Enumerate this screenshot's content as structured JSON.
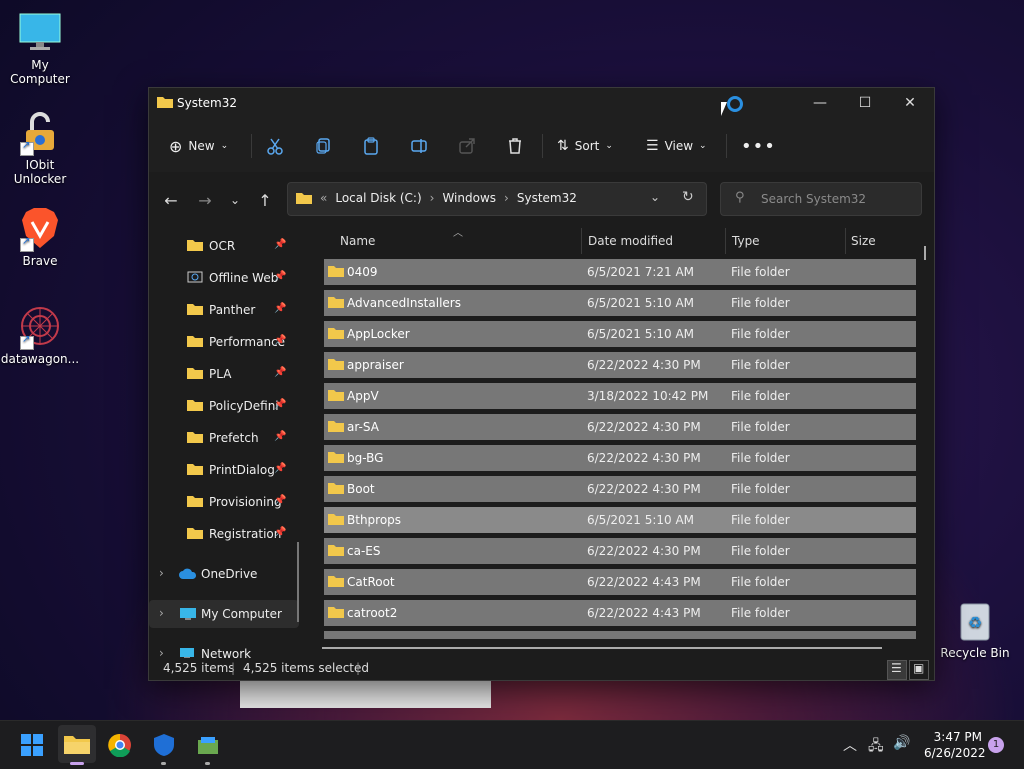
{
  "desktop": {
    "icons": [
      {
        "label": "My Computer"
      },
      {
        "label": "IObit Unlocker"
      },
      {
        "label": "Brave"
      },
      {
        "label": "datawagon..."
      },
      {
        "label": "Recycle Bin"
      }
    ]
  },
  "window": {
    "title": "System32",
    "toolbar": {
      "new_label": "New",
      "sort_label": "Sort",
      "view_label": "View"
    },
    "address": {
      "crumbs": [
        "Local Disk (C:)",
        "Windows",
        "System32"
      ]
    },
    "search": {
      "placeholder": "Search System32"
    },
    "nav": {
      "items": [
        "OCR",
        "Offline Web",
        "Panther",
        "Performance",
        "PLA",
        "PolicyDefini",
        "Prefetch",
        "PrintDialog",
        "Provisioning",
        "Registration"
      ],
      "onedrive": "OneDrive",
      "mycomputer": "My Computer",
      "network": "Network"
    },
    "columns": {
      "name": "Name",
      "date": "Date modified",
      "type": "Type",
      "size": "Size"
    },
    "rows": [
      {
        "name": "0409",
        "date": "6/5/2021 7:21 AM",
        "type": "File folder"
      },
      {
        "name": "AdvancedInstallers",
        "date": "6/5/2021 5:10 AM",
        "type": "File folder"
      },
      {
        "name": "AppLocker",
        "date": "6/5/2021 5:10 AM",
        "type": "File folder"
      },
      {
        "name": "appraiser",
        "date": "6/22/2022 4:30 PM",
        "type": "File folder"
      },
      {
        "name": "AppV",
        "date": "3/18/2022 10:42 PM",
        "type": "File folder"
      },
      {
        "name": "ar-SA",
        "date": "6/22/2022 4:30 PM",
        "type": "File folder"
      },
      {
        "name": "bg-BG",
        "date": "6/22/2022 4:30 PM",
        "type": "File folder"
      },
      {
        "name": "Boot",
        "date": "6/22/2022 4:30 PM",
        "type": "File folder"
      },
      {
        "name": "Bthprops",
        "date": "6/5/2021 5:10 AM",
        "type": "File folder"
      },
      {
        "name": "ca-ES",
        "date": "6/22/2022 4:30 PM",
        "type": "File folder"
      },
      {
        "name": "CatRoot",
        "date": "6/22/2022 4:43 PM",
        "type": "File folder"
      },
      {
        "name": "catroot2",
        "date": "6/22/2022 4:43 PM",
        "type": "File folder"
      }
    ],
    "status": {
      "items": "4,525 items",
      "selected": "4,525 items selected"
    }
  },
  "taskbar": {
    "time": "3:47 PM",
    "date": "6/26/2022",
    "notifications": "1"
  },
  "colors": {
    "folder": "#f2c84b",
    "accent": "#0078d4"
  }
}
